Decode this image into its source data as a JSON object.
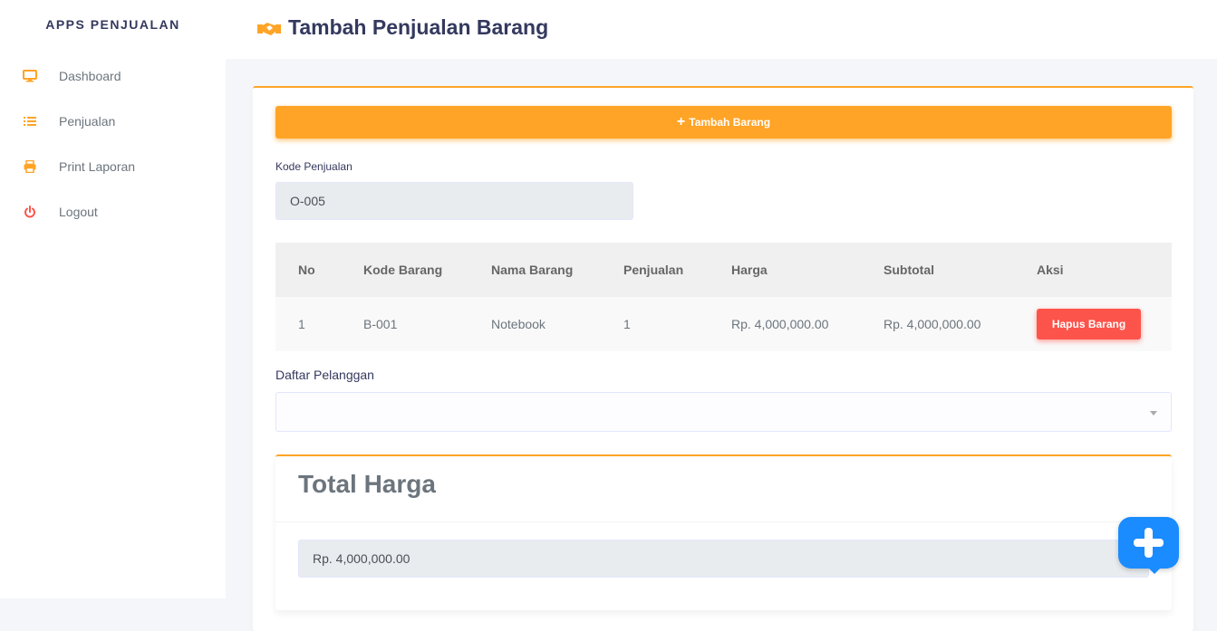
{
  "sidebar": {
    "brand": "APPS PENJUALAN",
    "items": [
      {
        "label": "Dashboard",
        "icon": "desktop-icon"
      },
      {
        "label": "Penjualan",
        "icon": "list-icon"
      },
      {
        "label": "Print Laporan",
        "icon": "print-icon"
      },
      {
        "label": "Logout",
        "icon": "power-icon"
      }
    ]
  },
  "header": {
    "title": "Tambah Penjualan Barang",
    "icon": "handshake-icon"
  },
  "form": {
    "add_button_label": "Tambah Barang",
    "kode_label": "Kode Penjualan",
    "kode_value": "O-005",
    "pelanggan_label": "Daftar Pelanggan",
    "pelanggan_value": ""
  },
  "table": {
    "headers": [
      "No",
      "Kode Barang",
      "Nama Barang",
      "Penjualan",
      "Harga",
      "Subtotal",
      "Aksi"
    ],
    "rows": [
      {
        "no": "1",
        "kode": "B-001",
        "nama": "Notebook",
        "penjualan": "1",
        "harga": "Rp. 4,000,000.00",
        "subtotal": "Rp. 4,000,000.00",
        "aksi": "Hapus Barang"
      }
    ]
  },
  "total": {
    "title": "Total Harga",
    "value": "Rp. 4,000,000.00"
  },
  "colors": {
    "accent": "#ffa426",
    "danger": "#fc544b",
    "chat": "#1a8cff"
  }
}
